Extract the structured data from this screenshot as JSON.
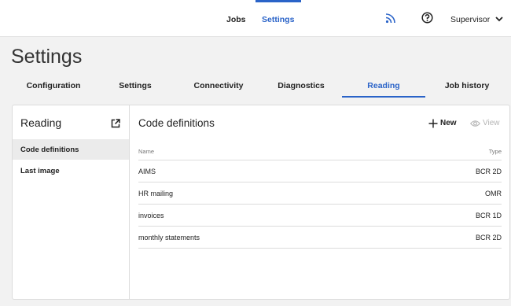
{
  "topbar": {
    "nav": [
      {
        "label": "Jobs",
        "active": false
      },
      {
        "label": "Settings",
        "active": true
      }
    ],
    "icons": {
      "feed": "rss-icon",
      "help": "help-icon",
      "user_menu": "chevron-down-icon"
    },
    "user_label": "Supervisor"
  },
  "page": {
    "title": "Settings"
  },
  "tabs": [
    {
      "label": "Configuration",
      "active": false
    },
    {
      "label": "Settings",
      "active": false
    },
    {
      "label": "Connectivity",
      "active": false
    },
    {
      "label": "Diagnostics",
      "active": false
    },
    {
      "label": "Reading",
      "active": true
    },
    {
      "label": "Job history",
      "active": false
    }
  ],
  "sidebar": {
    "title": "Reading",
    "open_icon": "external-link-icon",
    "items": [
      {
        "label": "Code definitions",
        "selected": true
      },
      {
        "label": "Last image",
        "selected": false
      }
    ]
  },
  "main": {
    "title": "Code definitions",
    "actions": {
      "new_label": "New",
      "view_label": "View",
      "view_enabled": false
    },
    "table": {
      "columns": [
        "Name",
        "Type"
      ],
      "rows": [
        {
          "name": "AIMS",
          "type": "BCR 2D"
        },
        {
          "name": "HR mailing",
          "type": "OMR"
        },
        {
          "name": "invoices",
          "type": "BCR 1D"
        },
        {
          "name": "monthly statements",
          "type": "BCR 2D"
        }
      ]
    }
  },
  "colors": {
    "accent": "#2a63c8",
    "disabled": "#b5b5b5",
    "background": "#f2f2f2"
  }
}
